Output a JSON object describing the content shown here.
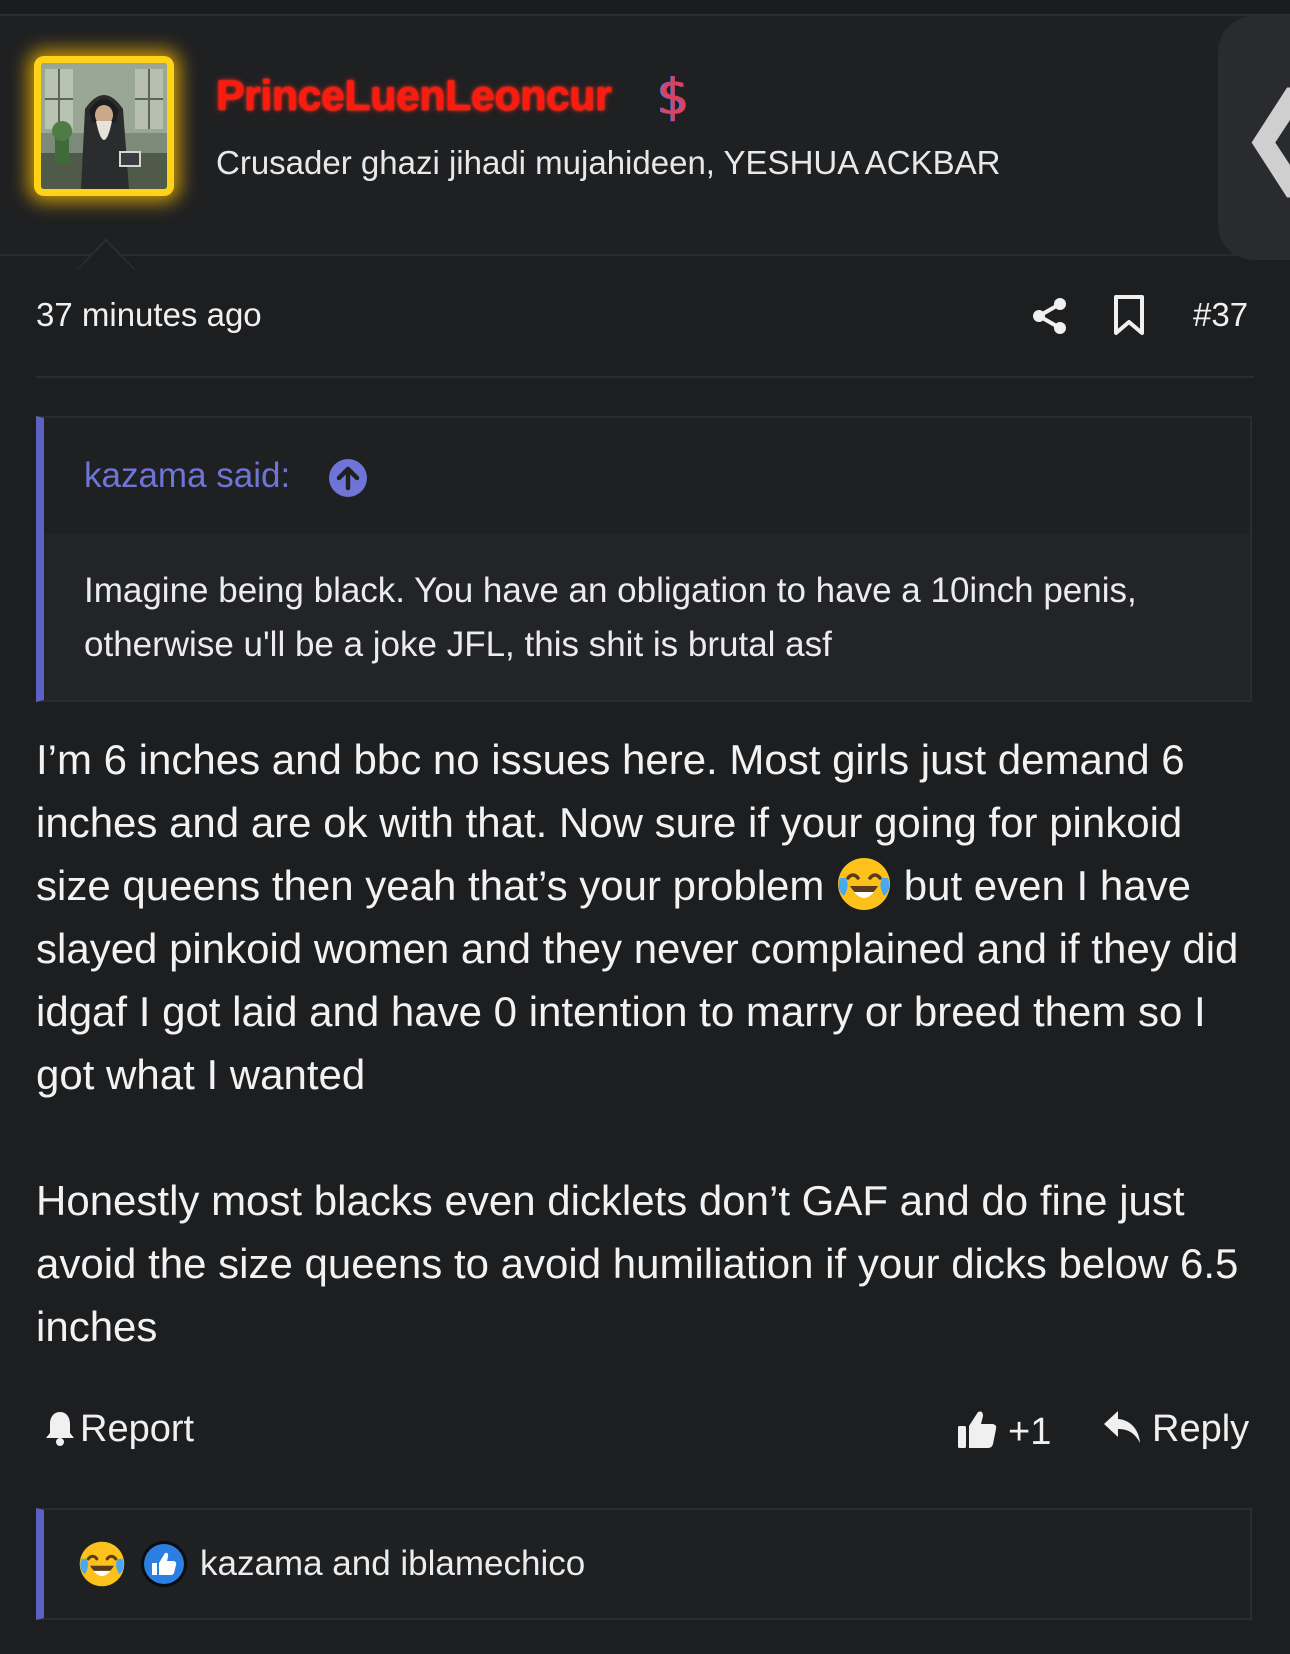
{
  "header": {
    "username": "PrinceLuenLeoncur",
    "badge": "$",
    "user_title": "Crusader ghazi jihadi mujahideen, YESHUA ACKBAR",
    "collapse_glyph": "❮"
  },
  "meta": {
    "timestamp": "37 minutes ago",
    "post_number": "#37"
  },
  "quote": {
    "author_line": "kazama said:",
    "text": "Imagine being black. You have an obligation to have a 10inch penis, otherwise u'll be a joke JFL, this shit is brutal asf"
  },
  "post": {
    "paragraph1_before_emoji": "I’m 6 inches and bbc no issues here. Most girls just demand 6 inches and are ok with that. Now sure if your going for pinkoid size queens then yeah that’s your problem ",
    "paragraph1_after_emoji": " but even I have slayed pinkoid women and they never complained and if they did idgaf I got laid and have 0 intention to marry or breed them so I got what I wanted",
    "paragraph2": "Honestly most blacks even dicklets don’t GAF and do fine just avoid the size queens to avoid humiliation if your dicks below 6.5 inches"
  },
  "actions": {
    "report_label": "Report",
    "like_label": "+1",
    "reply_label": "Reply"
  },
  "reactions": {
    "names": "kazama and iblamechico"
  },
  "colors": {
    "background": "#1d1e20",
    "username": "#ff1a10",
    "accent": "#5c62c4",
    "quote_author": "#6f75d6",
    "avatar_glow": "#ffd21a"
  },
  "icons": {
    "share": "share-icon",
    "bookmark": "bookmark-icon",
    "quote_jump": "arrow-up-circle-icon",
    "report": "bell-icon",
    "like": "thumbs-up-icon",
    "reply": "reply-arrow-icon",
    "emoji": "joy-crying-laughing-emoji"
  }
}
